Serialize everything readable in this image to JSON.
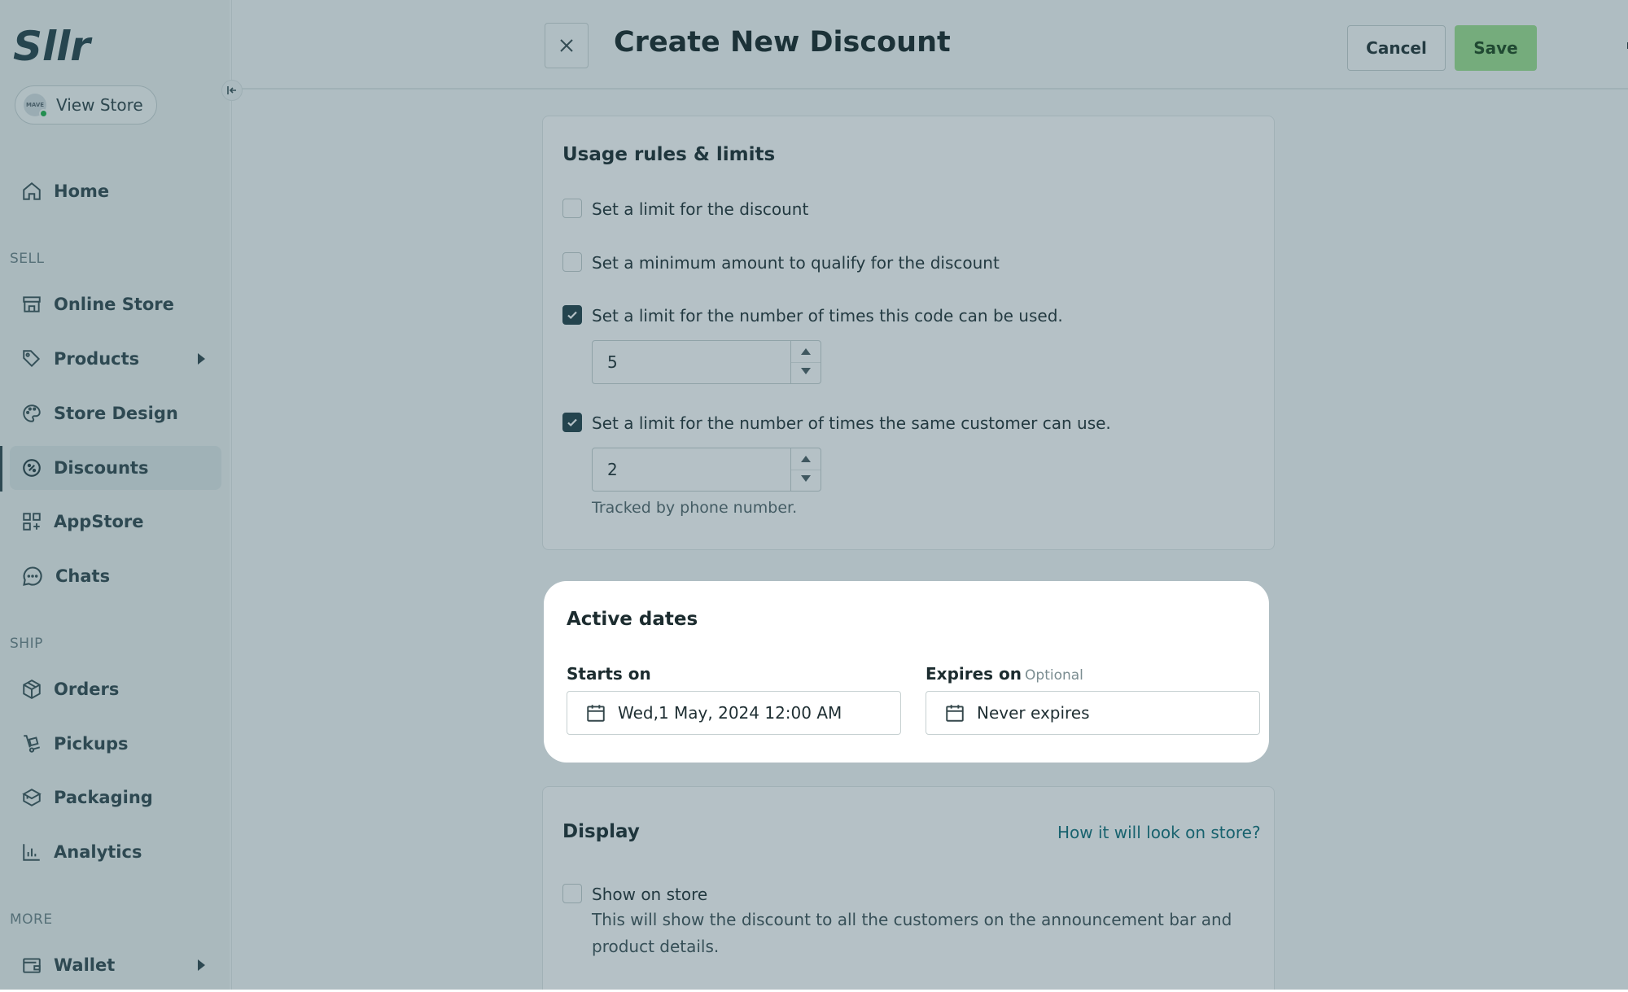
{
  "app": {
    "brand": "Sllr",
    "avatar_text": "MAVE"
  },
  "sidebar": {
    "view_store": "View Store",
    "home": "Home",
    "sections": {
      "sell": "SELL",
      "ship": "SHIP",
      "more": "MORE"
    },
    "items": {
      "online_store": "Online Store",
      "products": "Products",
      "store_design": "Store Design",
      "discounts": "Discounts",
      "appstore": "AppStore",
      "chats": "Chats",
      "orders": "Orders",
      "pickups": "Pickups",
      "packaging": "Packaging",
      "analytics": "Analytics",
      "wallet": "Wallet"
    },
    "active_item": "Discounts"
  },
  "header": {
    "title": "Create New Discount",
    "cancel_label": "Cancel",
    "save_label": "Save"
  },
  "usage": {
    "title": "Usage rules & limits",
    "limit_discount": {
      "label": "Set a limit for the discount",
      "checked": false
    },
    "min_amount": {
      "label": "Set a minimum amount to qualify for the discount",
      "checked": false
    },
    "code_uses": {
      "label": "Set a limit for the number of times this code can be used.",
      "checked": true,
      "value": "5"
    },
    "customer_uses": {
      "label": "Set a limit for the number of times the same customer can use.",
      "checked": true,
      "value": "2"
    },
    "helper": "Tracked by phone number."
  },
  "active_dates": {
    "title": "Active dates",
    "starts_label": "Starts on",
    "starts_value": "Wed,1 May, 2024 12:00 AM",
    "expires_label": "Expires on",
    "expires_optional": "Optional",
    "expires_value": "Never expires"
  },
  "display": {
    "title": "Display",
    "preview_link": "How it will look on store?",
    "show_on_store": {
      "label": "Show on store",
      "checked": false
    },
    "description": "This will show the discount to all the customers on the announcement bar and product details."
  },
  "colors": {
    "primary_dark": "#23424a",
    "save_green": "#9ee08f",
    "link_teal": "#11707a",
    "overlay": "#254858"
  }
}
